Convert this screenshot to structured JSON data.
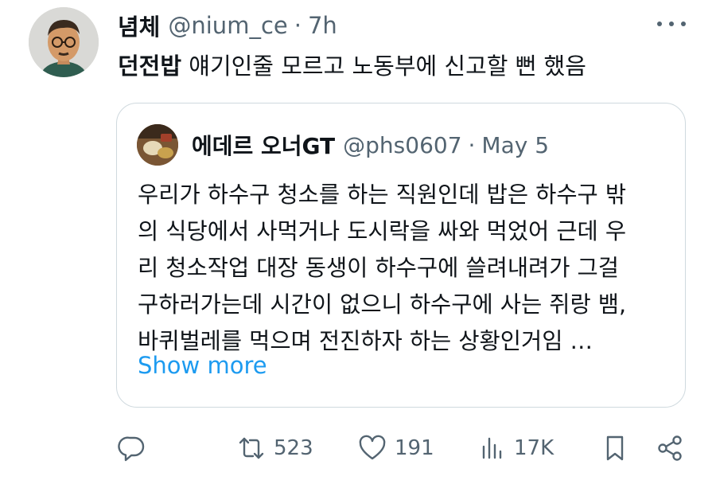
{
  "tweet": {
    "display_name": "념체",
    "handle": "@nium_ce",
    "separator": "·",
    "time": "7h",
    "text_bold": "던전밥",
    "text_rest": " 얘기인줄 모르고 노동부에 신고할 뻔 했음"
  },
  "quoted": {
    "display_name": "에데르 오너GT",
    "handle": "@phs0607",
    "separator": "·",
    "date": "May 5",
    "lines": [
      "우리가 하수구 청소를 하는 직원인데 밥은 하수구 밖",
      "의 식당에서 사먹거나 도시락을 싸와 먹었어 근데 우",
      "리 청소작업 대장 동생이 하수구에 쓸려내려가 그걸",
      "구하러가는데 시간이 없으니 하수구에 사는 쥐랑 뱀,",
      "바퀴벌레를 먹으며 전진하자 하는 상황인거임 …"
    ],
    "show_more": "Show more"
  },
  "actions": {
    "reply_icon": "reply-icon",
    "retweet_count": "523",
    "like_count": "191",
    "views_count": "17K",
    "bookmark_icon": "bookmark-icon",
    "share_icon": "share-icon"
  },
  "colors": {
    "text": "#0f1419",
    "secondary": "#536471",
    "link": "#1d9bf0",
    "border": "#cfd9de"
  }
}
